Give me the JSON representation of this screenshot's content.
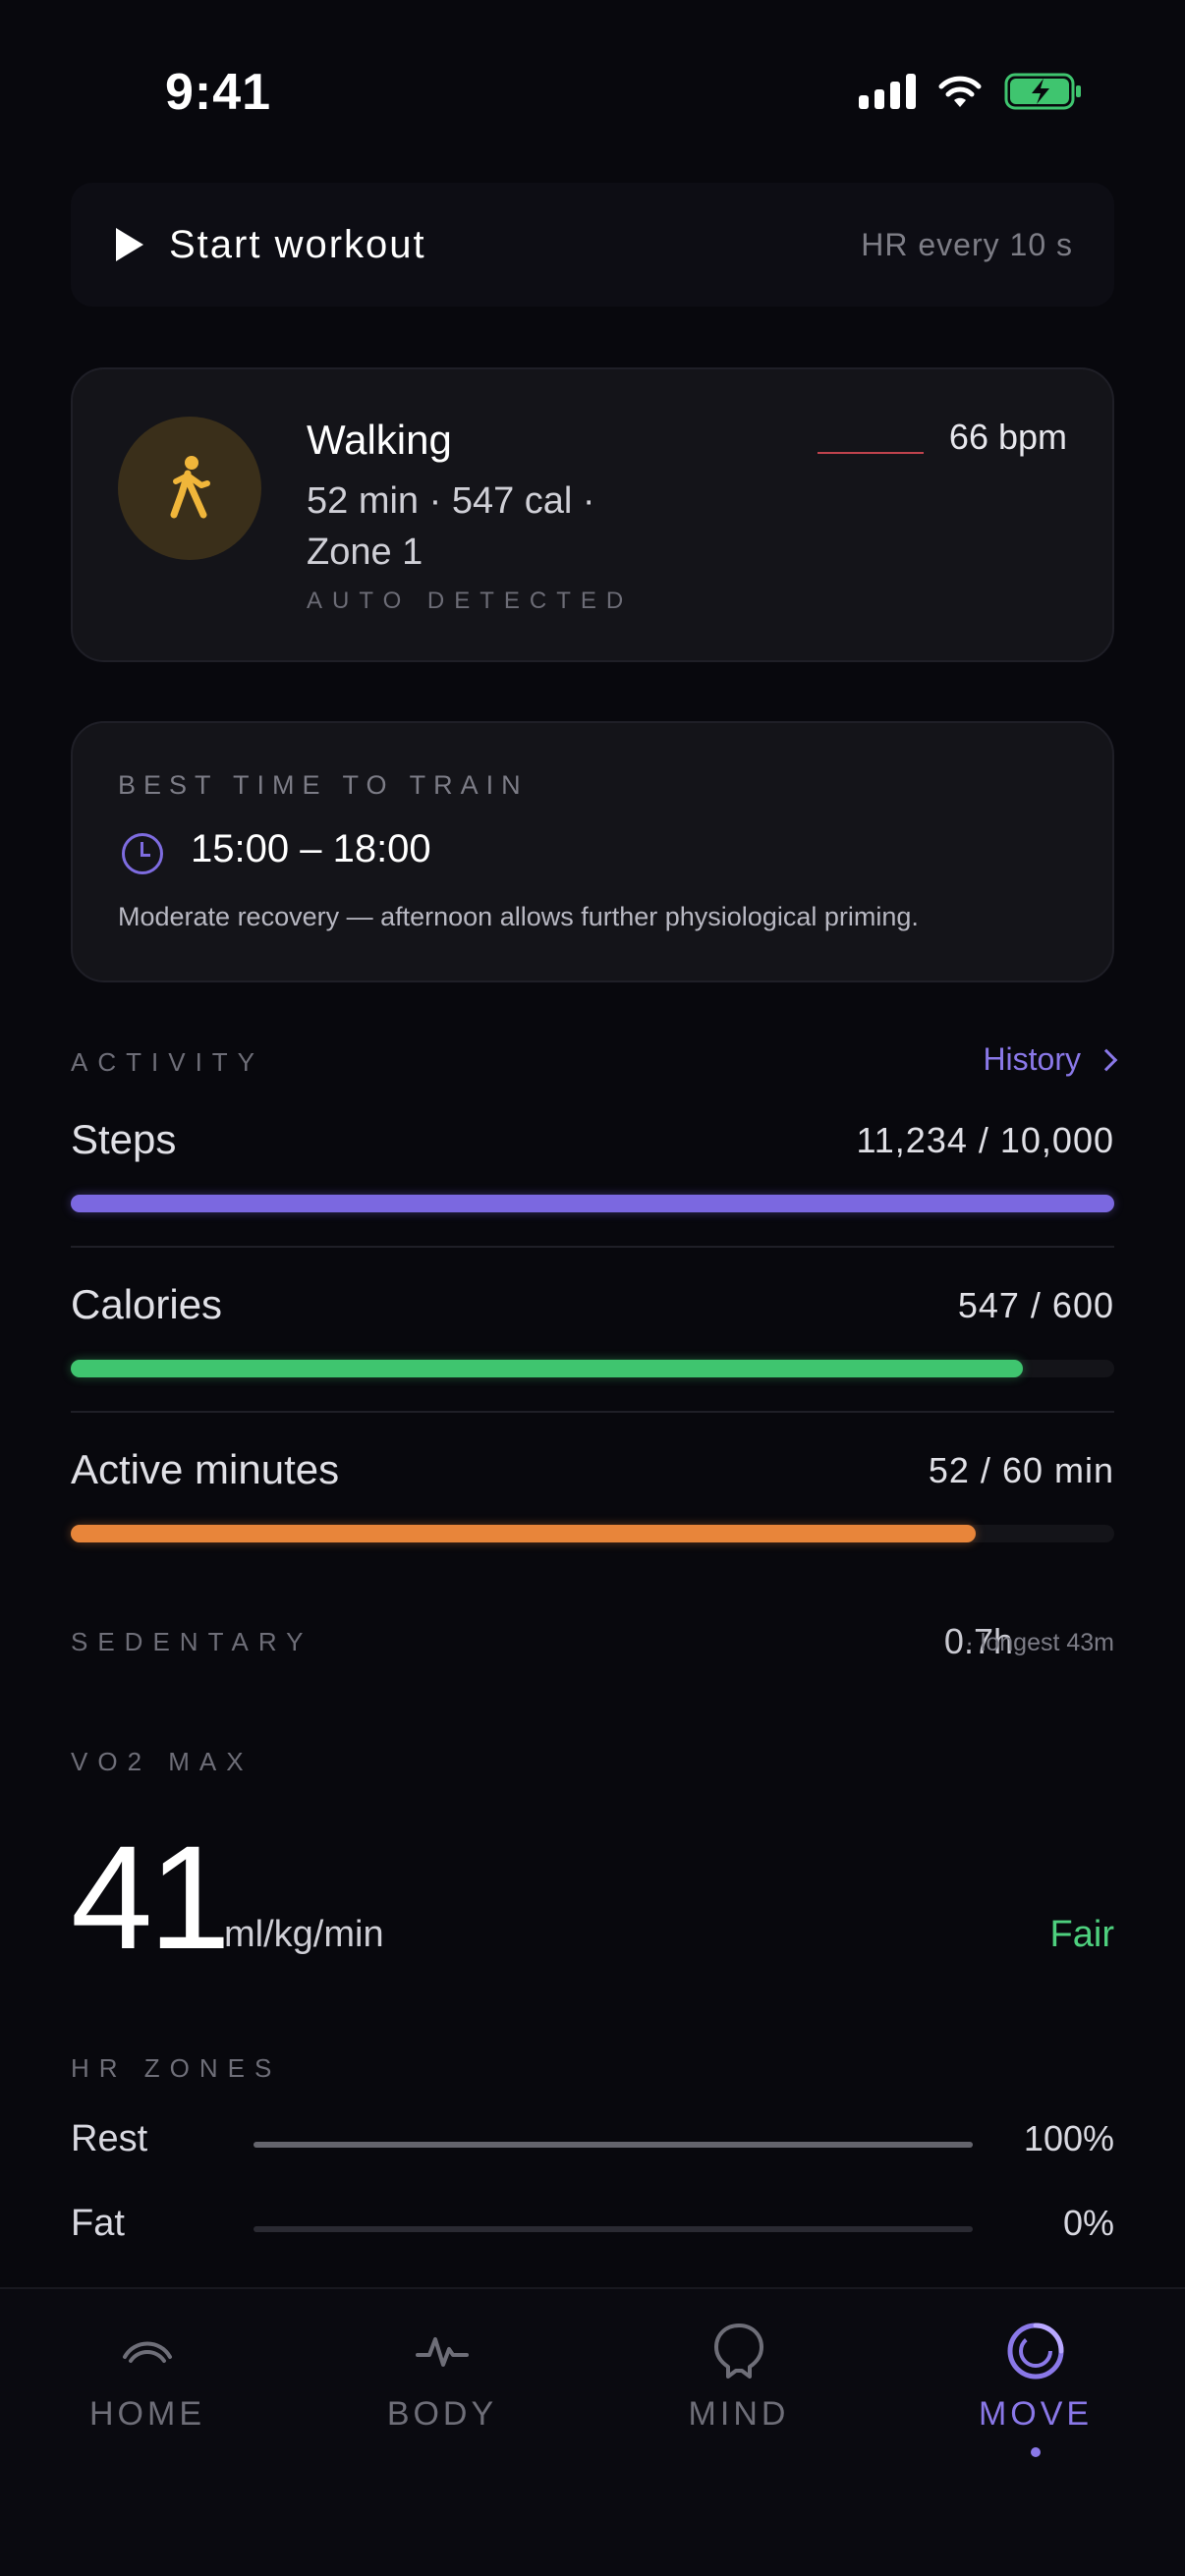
{
  "status": {
    "time": "9:41"
  },
  "workout": {
    "start_label": "Start workout",
    "hr_interval": "HR every 10 s"
  },
  "walking": {
    "title": "Walking",
    "stats": "52 min · 547 cal · Zone 1",
    "auto": "AUTO DETECTED",
    "bpm": "66 bpm"
  },
  "best_time": {
    "header": "BEST TIME TO TRAIN",
    "time": "15:00 – 18:00",
    "description": "Moderate recovery — afternoon allows further physiological priming."
  },
  "activity": {
    "label": "ACTIVITY",
    "history": "History",
    "metrics": [
      {
        "label": "Steps",
        "value": "11,234 / 10,000",
        "progress": 1.0,
        "color": "#7b68e0"
      },
      {
        "label": "Calories",
        "value": "547 / 600",
        "progress": 0.912,
        "color": "#3fc56f"
      },
      {
        "label": "Active minutes",
        "value": "52 / 60 min",
        "progress": 0.867,
        "color": "#e8853a"
      }
    ]
  },
  "sedentary": {
    "label": "SEDENTARY",
    "value": "0.7h",
    "sub": "· longest 43m"
  },
  "vo2": {
    "label": "VO2 MAX",
    "value": "41",
    "unit": "ml/kg/min",
    "rating": "Fair"
  },
  "hr_zones": {
    "label": "HR ZONES",
    "zones": [
      {
        "label": "Rest",
        "pct": "100%",
        "progress": 1.0
      },
      {
        "label": "Fat",
        "pct": "0%",
        "progress": 0.0
      }
    ]
  },
  "tabs": [
    {
      "label": "HOME",
      "icon": "home-icon"
    },
    {
      "label": "BODY",
      "icon": "pulse-icon"
    },
    {
      "label": "MIND",
      "icon": "head-icon"
    },
    {
      "label": "MOVE",
      "icon": "ring-icon",
      "active": true
    }
  ]
}
